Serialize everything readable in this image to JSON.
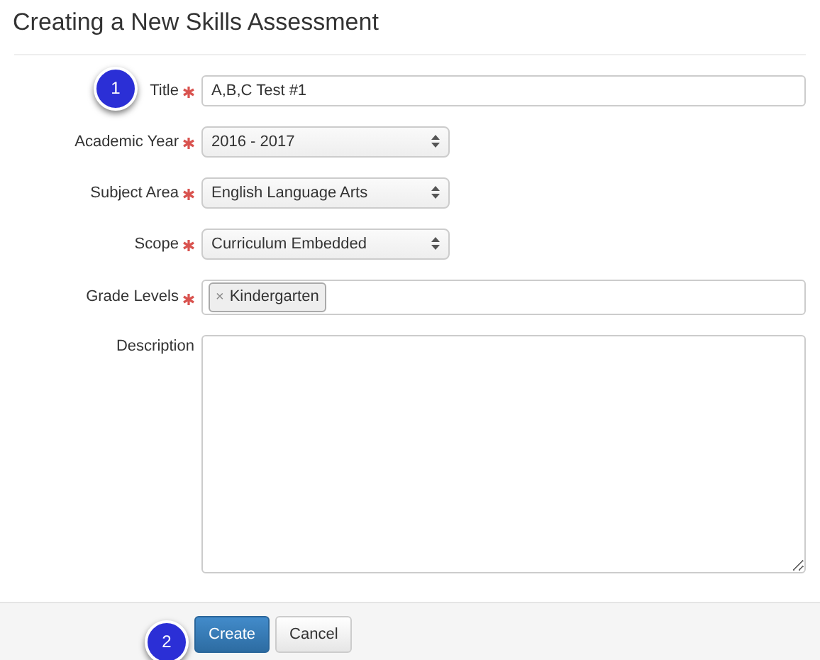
{
  "heading": "Creating a New Skills Assessment",
  "fields": [
    {
      "kind": "text",
      "label": "Title",
      "required": true,
      "value": "A,B,C Test #1",
      "callout": "1"
    },
    {
      "kind": "select",
      "label": "Academic Year",
      "required": true,
      "value": "2016 - 2017"
    },
    {
      "kind": "select",
      "label": "Subject Area",
      "required": true,
      "value": "English Language Arts"
    },
    {
      "kind": "select",
      "label": "Scope",
      "required": true,
      "value": "Curriculum Embedded"
    },
    {
      "kind": "tags",
      "label": "Grade Levels",
      "required": true,
      "tags": [
        {
          "remove": "×",
          "text": "Kindergarten"
        }
      ]
    },
    {
      "kind": "textarea",
      "label": "Description",
      "required": false
    }
  ],
  "footer": {
    "callout": "2",
    "buttons": [
      {
        "kind": "primary",
        "label": "Create"
      },
      {
        "kind": "default",
        "label": "Cancel"
      }
    ]
  }
}
